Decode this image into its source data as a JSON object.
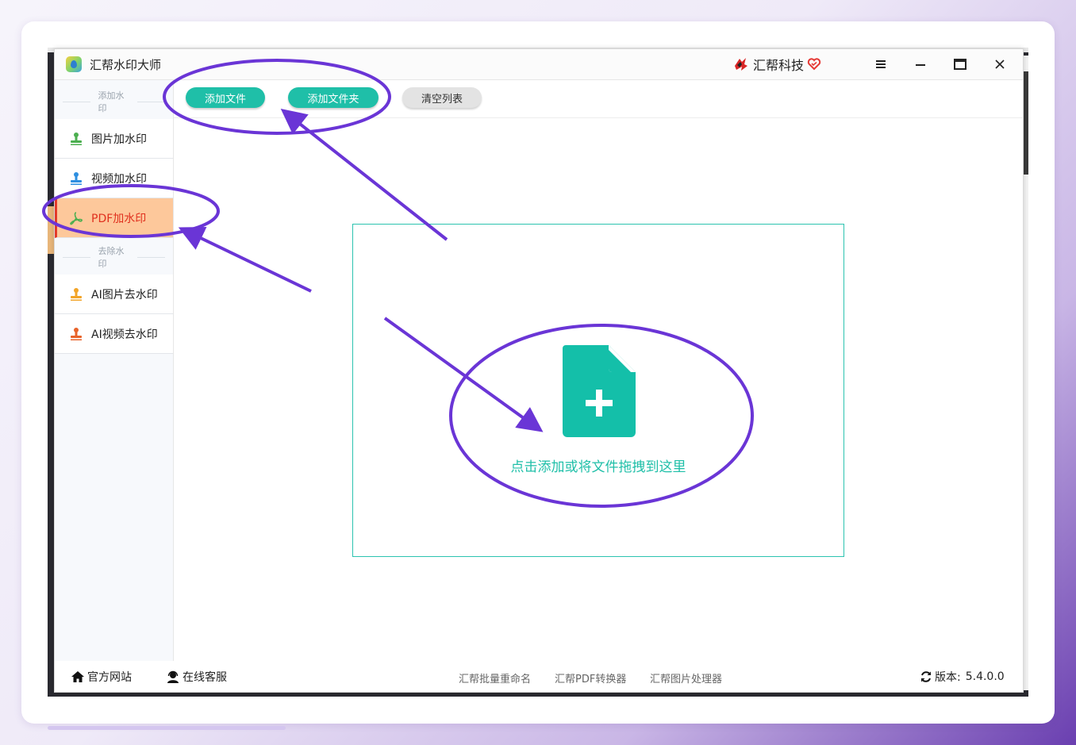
{
  "window": {
    "app_title": "汇帮水印大师",
    "brand_name": "汇帮科技"
  },
  "sidebar": {
    "section_add": "添加水印",
    "section_remove": "去除水印",
    "items": [
      {
        "label": "图片加水印",
        "icon": "stamp-icon",
        "color": "#4caf50"
      },
      {
        "label": "视频加水印",
        "icon": "stamp-icon",
        "color": "#2e8fe0"
      },
      {
        "label": "PDF加水印",
        "icon": "pdf-icon",
        "color": "#4caf50",
        "active": true
      },
      {
        "label": "AI图片去水印",
        "icon": "stamp-icon",
        "color": "#f2a428"
      },
      {
        "label": "AI视频去水印",
        "icon": "stamp-icon",
        "color": "#e8632a"
      }
    ]
  },
  "toolbar": {
    "add_file": "添加文件",
    "add_folder": "添加文件夹",
    "clear_list": "清空列表"
  },
  "dropzone": {
    "text": "点击添加或将文件拖拽到这里",
    "icon": "file-add-icon"
  },
  "footer": {
    "website": "官方网站",
    "support": "在线客服",
    "tools": [
      "汇帮批量重命名",
      "汇帮PDF转换器",
      "汇帮图片处理器"
    ],
    "version_label": "版本:",
    "version_value": "5.4.0.0"
  },
  "colors": {
    "accent": "#1fbfa8",
    "active_bg": "#fdc89b",
    "active_text": "#e0301e",
    "annotation": "#6a35d6"
  }
}
